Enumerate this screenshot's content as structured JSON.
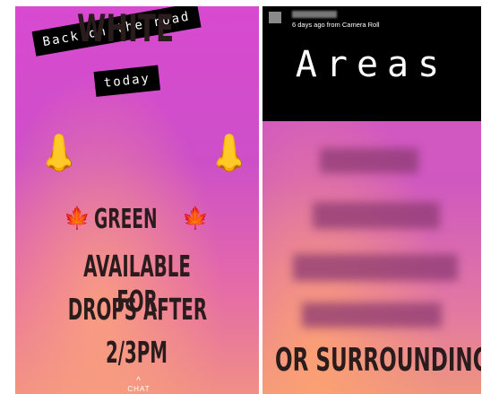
{
  "left_story": {
    "caption_line1": "Back on the road",
    "caption_line2": "today",
    "nose_emoji": "👃",
    "white_label": "WHITE",
    "leaf_emoji": "🍁",
    "green_label": "GREEN",
    "avail_line1": "AVAILABLE FOR",
    "avail_line2": "DROPS AFTER",
    "avail_line3": "2/3PM",
    "chat_label": "CHAT",
    "chat_chevron": "^"
  },
  "right_story": {
    "timestamp": "6 days ago from Camera Roll",
    "title": "Areas",
    "surrounding": "OR SURROUNDING"
  }
}
